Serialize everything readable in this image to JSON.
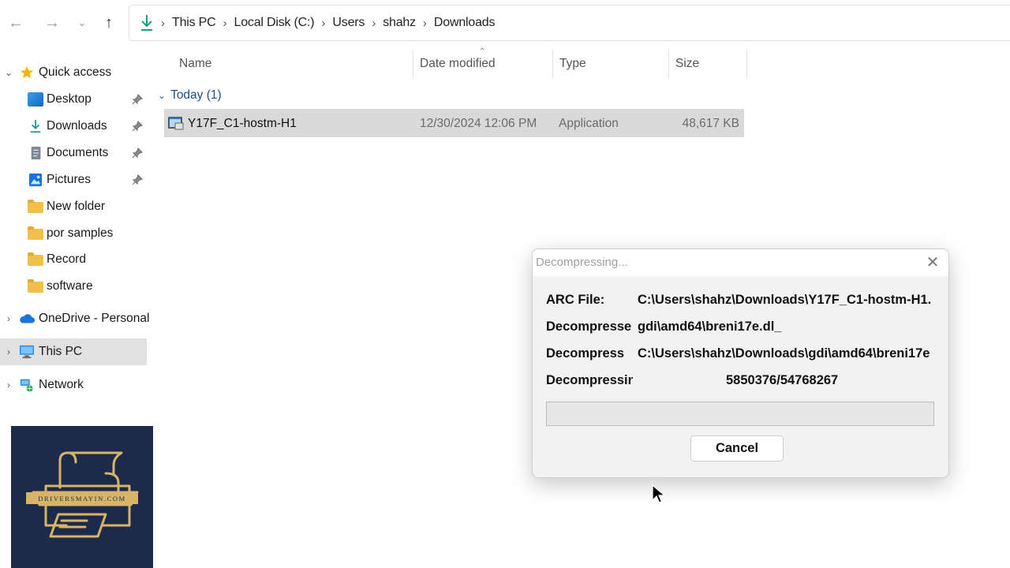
{
  "address_bar": {
    "crumbs": [
      "This PC",
      "Local Disk (C:)",
      "Users",
      "shahz",
      "Downloads"
    ]
  },
  "sidebar": {
    "quick_access": "Quick access",
    "pinned": [
      "Desktop",
      "Downloads",
      "Documents",
      "Pictures"
    ],
    "folders": [
      "New folder",
      "por samples",
      "Record",
      "software"
    ],
    "onedrive": "OneDrive - Personal",
    "this_pc": "This PC",
    "network": "Network"
  },
  "columns": {
    "name": "Name",
    "date": "Date modified",
    "type": "Type",
    "size": "Size"
  },
  "group": {
    "label": "Today (1)"
  },
  "files": [
    {
      "name": "Y17F_C1-hostm-H1",
      "date": "12/30/2024 12:06 PM",
      "type": "Application",
      "size": "48,617 KB"
    }
  ],
  "dialog": {
    "title": "Decompressing...",
    "rows": [
      {
        "label": "ARC File:",
        "value": "C:\\Users\\shahz\\Downloads\\Y17F_C1-hostm-H1."
      },
      {
        "label": "Decompressed",
        "value": "gdi\\amd64\\breni17e.dl_"
      },
      {
        "label": "Decompress",
        "value": "C:\\Users\\shahz\\Downloads\\gdi\\amd64\\breni17e"
      },
      {
        "label": "Decompressing",
        "value": "5850376/54768267"
      }
    ],
    "progress_fraction": 0.0,
    "cancel_label": "Cancel"
  },
  "logo": {
    "text": "DRIVERSMAYIN.COM"
  },
  "colors": {
    "selected_row": "#d9d9d9",
    "dialog_bg": "#f2f2f2",
    "logo_bg": "#1d2b4b",
    "logo_gold": "#d7b468"
  }
}
